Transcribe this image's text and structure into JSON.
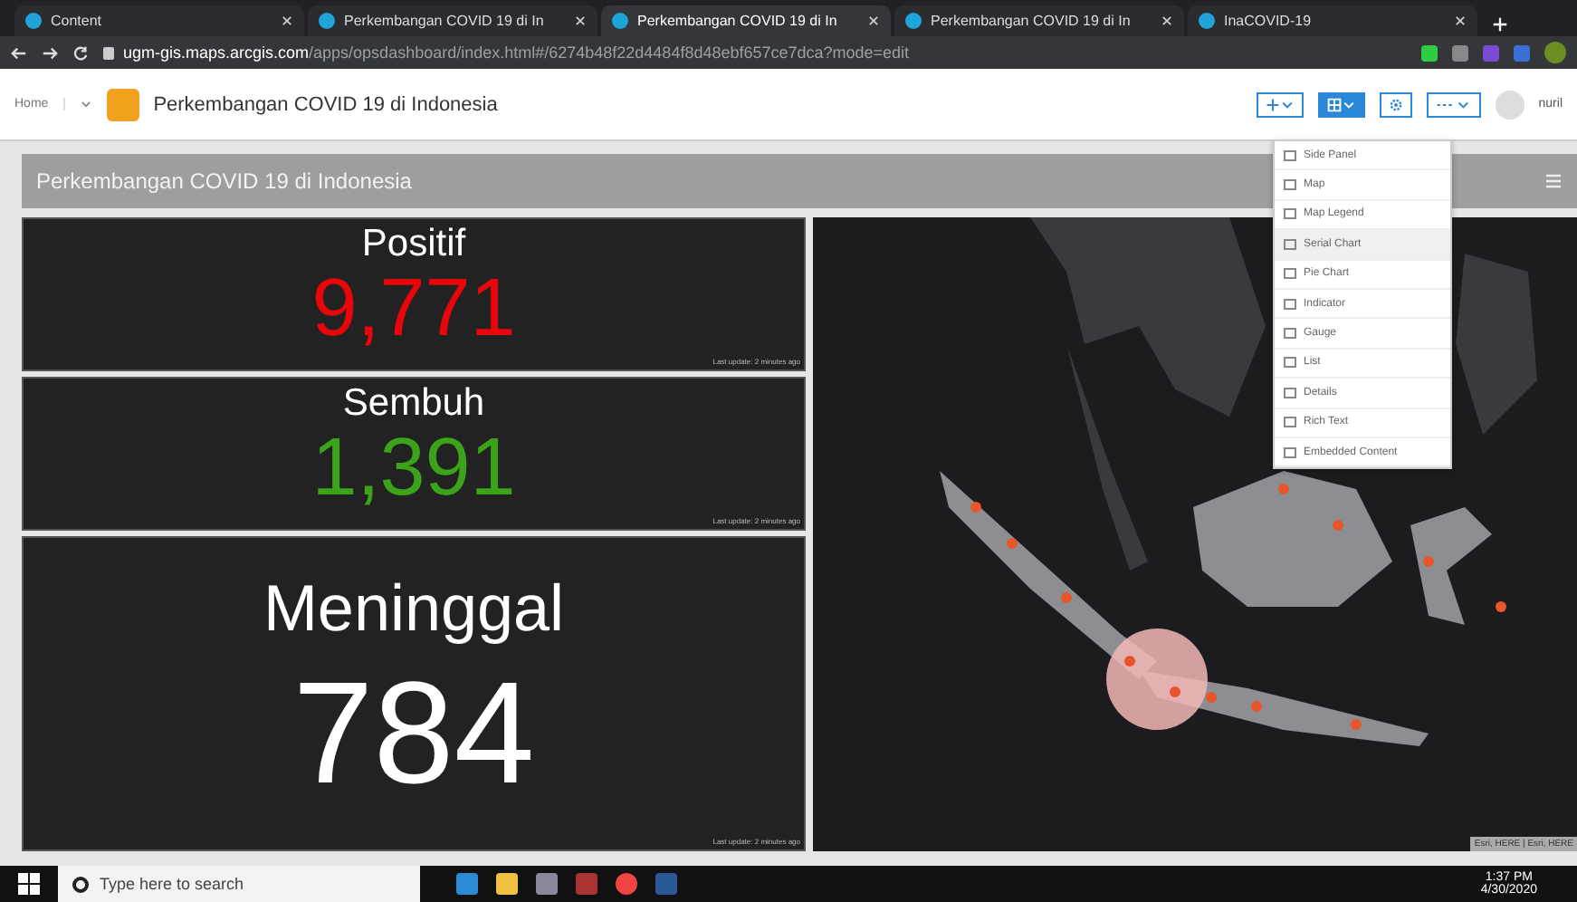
{
  "browser": {
    "tabs": [
      {
        "title": "Content",
        "selected": false
      },
      {
        "title": "Perkembangan COVID 19 di In",
        "selected": false
      },
      {
        "title": "Perkembangan COVID 19 di In",
        "selected": true
      },
      {
        "title": "Perkembangan COVID 19 di In",
        "selected": false
      },
      {
        "title": "InaCOVID-19",
        "selected": false
      }
    ],
    "address": {
      "host": "ugm-gis.maps.arcgis.com",
      "path": "/apps/opsdashboard/index.html#/6274b48f22d4484f8d48ebf657ce7dca?mode=edit"
    }
  },
  "app_header": {
    "home": "Home",
    "title": "Perkembangan COVID 19 di Indonesia",
    "user": "nuril"
  },
  "add_menu": {
    "items": [
      {
        "label": "Side Panel",
        "selected": false
      },
      {
        "label": "Map",
        "selected": false
      },
      {
        "label": "Map Legend",
        "selected": false
      },
      {
        "label": "Serial Chart",
        "selected": true
      },
      {
        "label": "Pie Chart",
        "selected": false
      },
      {
        "label": "Indicator",
        "selected": false
      },
      {
        "label": "Gauge",
        "selected": false
      },
      {
        "label": "List",
        "selected": false
      },
      {
        "label": "Details",
        "selected": false
      },
      {
        "label": "Rich Text",
        "selected": false
      },
      {
        "label": "Embedded Content",
        "selected": false
      }
    ]
  },
  "dashboard": {
    "title": "Perkembangan COVID 19 di Indonesia",
    "indicators": [
      {
        "label": "Positif",
        "value": "9,771",
        "color": "#e8060b",
        "note": "Last update: 2 minutes ago",
        "kind": "small"
      },
      {
        "label": "Sembuh",
        "value": "1,391",
        "color": "#3aa31a",
        "note": "Last update: 2 minutes ago",
        "kind": "small"
      },
      {
        "label": "Meninggal",
        "value": "784",
        "color": "#ffffff",
        "note": "Last update: 2 minutes ago",
        "kind": "large"
      }
    ],
    "map": {
      "attribution": "Esri, HERE | Esri, HERE"
    }
  },
  "taskbar": {
    "search_placeholder": "Type here to search",
    "time": "1:37 PM",
    "date": "4/30/2020"
  }
}
